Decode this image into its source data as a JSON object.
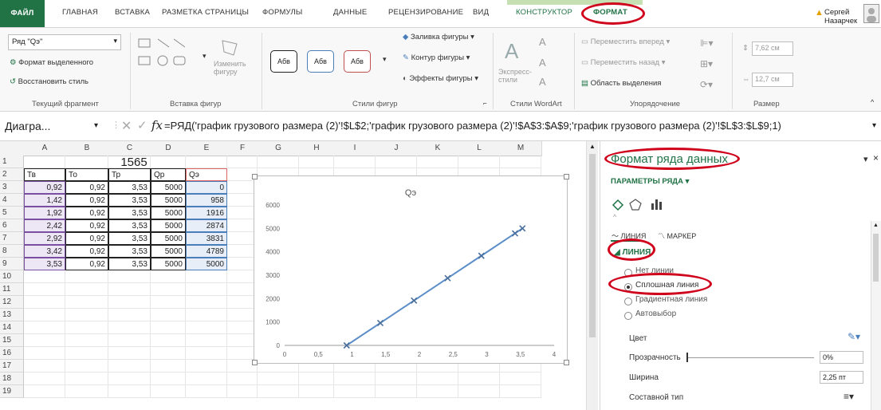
{
  "tabs": {
    "file": "ФАЙЛ",
    "items": [
      "ГЛАВНАЯ",
      "ВСТАВКА",
      "РАЗМЕТКА СТРАНИЦЫ",
      "ФОРМУЛЫ",
      "ДАННЫЕ",
      "РЕЦЕНЗИРОВАНИЕ",
      "ВИД"
    ],
    "ctx_design": "КОНСТРУКТОР",
    "ctx_format": "ФОРМАТ"
  },
  "user": {
    "name": "Сергей Назарчек",
    "warning_icon": "warning-icon"
  },
  "ribbon": {
    "current_selection": {
      "combo_value": "Ряд \"Qэ\"",
      "format_selection": "Формат выделенного",
      "reset_style": "Восстановить стиль",
      "label": "Текущий фрагмент"
    },
    "insert_shapes": {
      "change_shape": "Изменить фигуру",
      "label": "Вставка фигур"
    },
    "shape_styles": {
      "style_samples": [
        "Абв",
        "Абв",
        "Абв"
      ],
      "fill": "Заливка фигуры",
      "outline": "Контур фигуры",
      "effects": "Эффекты фигуры",
      "label": "Стили фигур"
    },
    "wordart": {
      "express": "Экспресс-стили",
      "label": "Стили WordArt"
    },
    "arrange": {
      "bring_forward": "Переместить вперед",
      "send_backward": "Переместить назад",
      "selection_pane": "Область выделения",
      "label": "Упорядочение"
    },
    "size": {
      "height": "7,62 см",
      "width": "12,7 см",
      "label": "Размер"
    }
  },
  "formula_bar": {
    "name_box": "Диагра...",
    "fx": "fx",
    "formula": "=РЯД('график грузового размера (2)'!$L$2;'график грузового размера (2)'!$A$3:$A$9;'график грузового размера (2)'!$L$3:$L$9;1)"
  },
  "columns": [
    "A",
    "B",
    "C",
    "D",
    "E",
    "F",
    "G",
    "H",
    "I",
    "J",
    "K",
    "L",
    "M"
  ],
  "rows": [
    "1",
    "2",
    "3",
    "4",
    "5",
    "6",
    "7",
    "8",
    "9",
    "10",
    "11",
    "12",
    "13",
    "14",
    "15",
    "16",
    "17",
    "18",
    "19"
  ],
  "sheet": {
    "title": "1565",
    "headers": [
      "Тв",
      "То",
      "Тр",
      "Qр",
      "Qэ"
    ],
    "data": [
      [
        "0,92",
        "0,92",
        "3,53",
        "5000",
        "0"
      ],
      [
        "1,42",
        "0,92",
        "3,53",
        "5000",
        "958"
      ],
      [
        "1,92",
        "0,92",
        "3,53",
        "5000",
        "1916"
      ],
      [
        "2,42",
        "0,92",
        "3,53",
        "5000",
        "2874"
      ],
      [
        "2,92",
        "0,92",
        "3,53",
        "5000",
        "3831"
      ],
      [
        "3,42",
        "0,92",
        "3,53",
        "5000",
        "4789"
      ],
      [
        "3,53",
        "0,92",
        "3,53",
        "5000",
        "5000"
      ]
    ]
  },
  "chart_data": {
    "type": "scatter",
    "title": "Qэ",
    "x": [
      0.92,
      1.42,
      1.92,
      2.42,
      2.92,
      3.42,
      3.53
    ],
    "series": [
      {
        "values": [
          0,
          958,
          1916,
          2874,
          3831,
          4789,
          5000
        ]
      }
    ],
    "xlim": [
      0,
      4
    ],
    "ylim": [
      0,
      6000
    ],
    "x_ticks": [
      "0",
      "0,5",
      "1",
      "1,5",
      "2",
      "2,5",
      "3",
      "3,5",
      "4"
    ],
    "y_ticks": [
      "0",
      "1000",
      "2000",
      "3000",
      "4000",
      "5000",
      "6000"
    ],
    "line_color": "#5b8ec9",
    "grid": false
  },
  "pane": {
    "title": "Формат ряда данных",
    "section": "ПАРАМЕТРЫ РЯДА",
    "tab_line": "ЛИНИЯ",
    "tab_marker": "МАРКЕР",
    "group_line": "ЛИНИЯ",
    "options": [
      "Нет линии",
      "Сплошная линия",
      "Градиентная линия",
      "Автовыбор"
    ],
    "selected_option": 1,
    "color_label": "Цвет",
    "transparency_label": "Прозрачность",
    "transparency_value": "0%",
    "width_label": "Ширина",
    "width_value": "2,25 пт",
    "compound_label": "Составной тип"
  },
  "colors": {
    "excel_green": "#217346",
    "highlight": "#d0021b",
    "ctx_tab_band": "#c6e0b4"
  }
}
